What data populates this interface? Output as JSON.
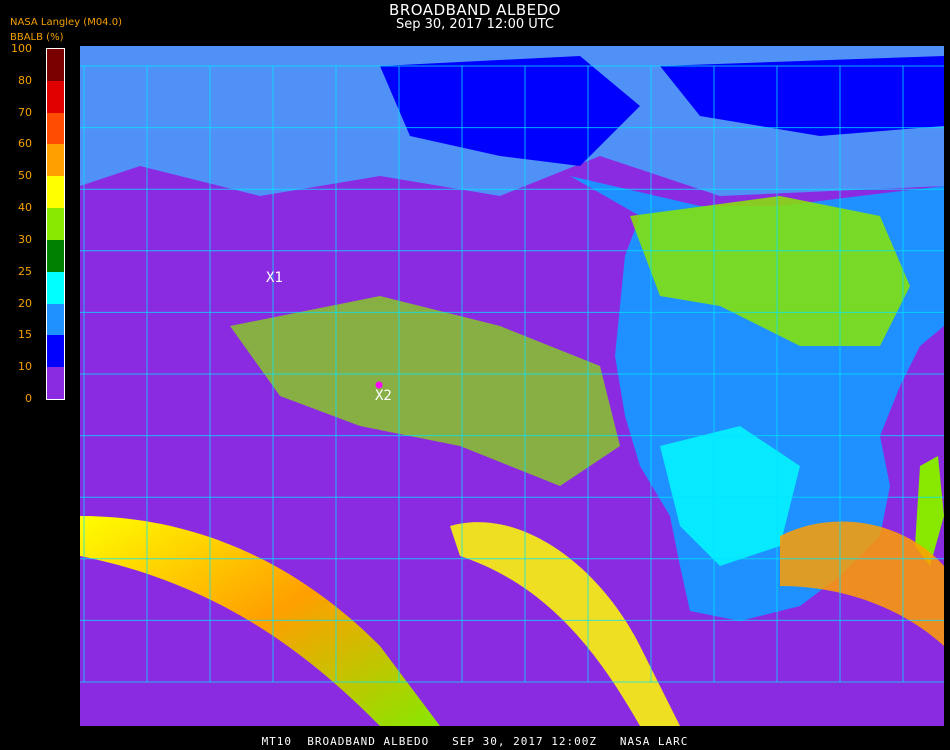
{
  "header": {
    "title": "BROADBAND ALBEDO",
    "subtitle": "Sep 30, 2017 12:00 UTC"
  },
  "legend": {
    "source": "NASA Langley (M04.0)",
    "unit_label": "BBALB (%)",
    "ticks": [
      "100",
      "80",
      "70",
      "60",
      "50",
      "40",
      "30",
      "25",
      "20",
      "15",
      "10",
      "0"
    ],
    "bins": [
      {
        "from": 80,
        "to": 100,
        "color": "#7a0000"
      },
      {
        "from": 70,
        "to": 80,
        "color": "#e00000"
      },
      {
        "from": 60,
        "to": 70,
        "color": "#ff4c00"
      },
      {
        "from": 50,
        "to": 60,
        "color": "#ff9f00"
      },
      {
        "from": 40,
        "to": 50,
        "color": "#ffff00"
      },
      {
        "from": 30,
        "to": 40,
        "color": "#88e800"
      },
      {
        "from": 25,
        "to": 30,
        "color": "#008000"
      },
      {
        "from": 20,
        "to": 25,
        "color": "#00ffff"
      },
      {
        "from": 15,
        "to": 20,
        "color": "#1e90ff"
      },
      {
        "from": 10,
        "to": 15,
        "color": "#0000ff"
      },
      {
        "from": 0,
        "to": 10,
        "color": "#8a2be2"
      }
    ]
  },
  "map": {
    "grid_color": "#00e5ff",
    "markers": [
      {
        "label": "X1"
      },
      {
        "label": "X2"
      }
    ]
  },
  "footer": {
    "text": "MT10  BROADBAND ALBEDO   SEP 30, 2017 12:00Z   NASA LARC"
  }
}
